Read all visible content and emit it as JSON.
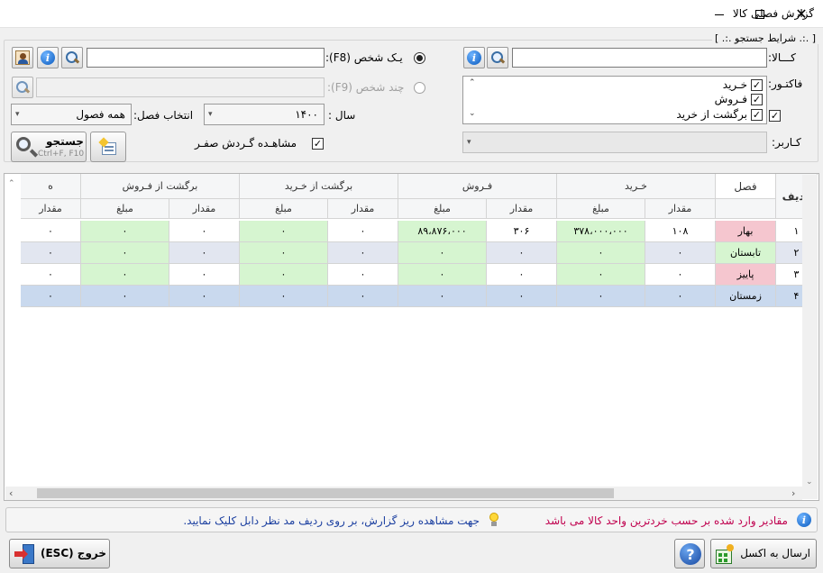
{
  "window": {
    "title": "گزارش فصلی کالا"
  },
  "search_group": {
    "title": "[ .:. شرایط جستجو .:. ]"
  },
  "product": {
    "label": "کـــالا:",
    "value": ""
  },
  "factor": {
    "label": "فاکتـور:",
    "options": [
      {
        "label": "خـرید",
        "checked": true
      },
      {
        "label": "فـروش",
        "checked": true
      },
      {
        "label": "برگشت از خرید",
        "checked": true
      }
    ]
  },
  "user": {
    "label": "کـاربر:",
    "value": ""
  },
  "person": {
    "single_label": "یـک شخص (F8):",
    "multi_label": "چند شخص (F9):",
    "value": ""
  },
  "season": {
    "label": "انتخاب فصل:",
    "value": "همه فصول"
  },
  "year": {
    "label": "سال :",
    "value": "۱۴۰۰"
  },
  "show_zero": {
    "label": "مشاهـده گـردش صفـر",
    "checked": true
  },
  "search_button": {
    "label": "جستجو",
    "shortcut": "Ctrl+F, F10"
  },
  "table": {
    "col_row": "ردیف",
    "col_season": "فصل",
    "groups": [
      "خـرید",
      "فـروش",
      "برگشت از خـرید",
      "برگشت از فـروش",
      "ه"
    ],
    "sub_qty": "مقدار",
    "sub_amount": "مبلغ",
    "rows": [
      {
        "row": "۱",
        "season": "بهار",
        "buy_qty": "۱۰۸",
        "buy_amount": "۳۷۸،۰۰۰،۰۰۰",
        "sell_qty": "۳۰۶",
        "sell_amount": "۸۹،۸۷۶،۰۰۰",
        "rbuy_qty": "۰",
        "rbuy_amount": "۰",
        "rsell_qty": "۰",
        "rsell_amount": "۰",
        "extra": "۰"
      },
      {
        "row": "۲",
        "season": "تابستان",
        "buy_qty": "۰",
        "buy_amount": "۰",
        "sell_qty": "۰",
        "sell_amount": "۰",
        "rbuy_qty": "۰",
        "rbuy_amount": "۰",
        "rsell_qty": "۰",
        "rsell_amount": "۰",
        "extra": "۰"
      },
      {
        "row": "۳",
        "season": "پاییز",
        "buy_qty": "۰",
        "buy_amount": "۰",
        "sell_qty": "۰",
        "sell_amount": "۰",
        "rbuy_qty": "۰",
        "rbuy_amount": "۰",
        "rsell_qty": "۰",
        "rsell_amount": "۰",
        "extra": "۰"
      },
      {
        "row": "۴",
        "season": "زمستان",
        "buy_qty": "۰",
        "buy_amount": "۰",
        "sell_qty": "۰",
        "sell_amount": "۰",
        "rbuy_qty": "۰",
        "rbuy_amount": "۰",
        "rsell_qty": "۰",
        "rsell_amount": "۰",
        "extra": "۰"
      }
    ]
  },
  "status": {
    "info": "مقادیر وارد شده بر حسب خردترین واحد کالا می باشد",
    "hint": "جهت مشاهده ریز گزارش، بر روی ردیف  مد نظر دابل کلیک نمایید."
  },
  "buttons": {
    "excel": "ارسال به اکسل",
    "exit": "خروج (ESC)"
  },
  "colors": {
    "accent_pink": "#f5c6cf",
    "accent_green": "#d6f5d0",
    "selected_row": "#c9d9ee",
    "alt_row": "#e2e6f0",
    "status_red": "#c0004e",
    "status_blue": "#1b3fa0"
  }
}
